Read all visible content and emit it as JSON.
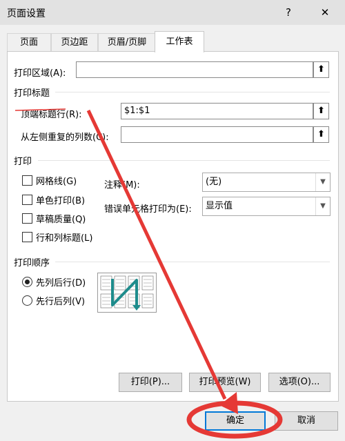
{
  "window": {
    "title": "页面设置",
    "help_label": "?",
    "close_label": "✕"
  },
  "tabs": [
    {
      "label": "页面"
    },
    {
      "label": "页边距"
    },
    {
      "label": "页眉/页脚"
    },
    {
      "label": "工作表"
    }
  ],
  "print_area": {
    "label": "打印区域(A):",
    "value": ""
  },
  "print_titles": {
    "section_label": "打印标题",
    "rows_label": "顶端标题行(R):",
    "rows_value": "$1:$1",
    "cols_label": "从左侧重复的列数(C):",
    "cols_value": ""
  },
  "print": {
    "section_label": "打印",
    "gridlines_label": "网格线(G)",
    "mono_label": "单色打印(B)",
    "draft_label": "草稿质量(Q)",
    "headings_label": "行和列标题(L)",
    "comments_label": "注释(M):",
    "comments_value": "(无)",
    "errors_label": "错误单元格打印为(E):",
    "errors_value": "显示值"
  },
  "page_order": {
    "section_label": "打印顺序",
    "down_then_over_label": "先列后行(D)",
    "over_then_down_label": "先行后列(V)"
  },
  "buttons": {
    "print_label": "打印(P)...",
    "preview_label": "打印预览(W)",
    "options_label": "选项(O)...",
    "ok_label": "确定",
    "cancel_label": "取消"
  },
  "colors": {
    "annotation_red": "#e53935",
    "accent_blue": "#0078d7"
  }
}
